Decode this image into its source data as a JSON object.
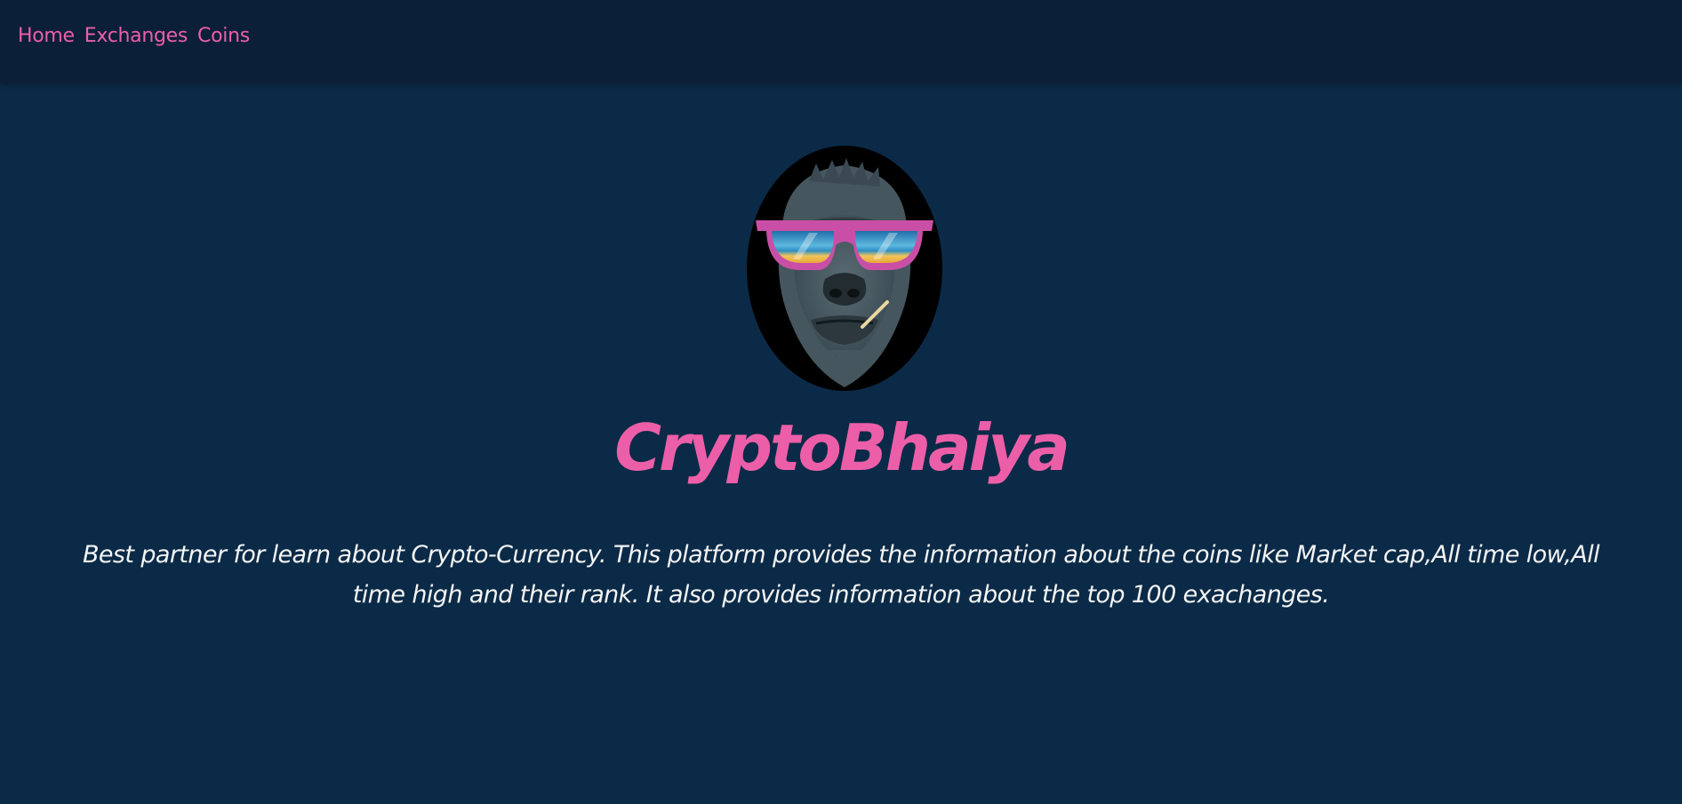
{
  "nav": {
    "items": [
      {
        "label": "Home"
      },
      {
        "label": "Exchanges"
      },
      {
        "label": "Coins"
      }
    ]
  },
  "hero": {
    "logo_icon": "gorilla-sunglasses-icon",
    "title": "CryptoBhaiya",
    "description": "Best partner for learn about Crypto-Currency. This platform provides the information about the coins like Market cap,All time low,All time high and their rank. It also provides information about the top 100 exachanges."
  },
  "colors": {
    "background": "#0b2a47",
    "navbar": "#0b1f38",
    "accent": "#ec5fa8",
    "text": "#f4f4f4"
  }
}
